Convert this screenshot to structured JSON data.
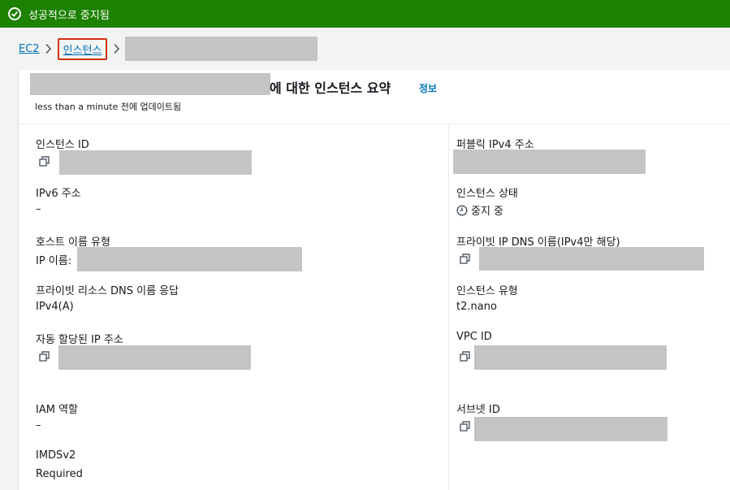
{
  "banner": {
    "message": "성공적으로 중지됨"
  },
  "breadcrumb": {
    "ec2": "EC2",
    "instances": "인스턴스"
  },
  "summary": {
    "title_suffix": "에 대한 인스턴스 요약",
    "info": "정보",
    "updated": "less than a minute 전에 업데이트됨"
  },
  "fields": {
    "instance_id": {
      "label": "인스턴스 ID"
    },
    "ipv6": {
      "label": "IPv6 주소",
      "value": "–"
    },
    "hostname_type": {
      "label": "호스트 이름 유형",
      "value_prefix": "IP 이름:"
    },
    "private_dns_answer": {
      "label": "프라이빗 리소스 DNS 이름 응답",
      "value": "IPv4(A)"
    },
    "auto_ip": {
      "label": "자동 할당된 IP 주소"
    },
    "iam_role": {
      "label": "IAM 역할",
      "value": "–"
    },
    "imdsv2": {
      "label": "IMDSv2",
      "value": "Required"
    },
    "public_ipv4": {
      "label": "퍼블릭 IPv4 주소"
    },
    "instance_state": {
      "label": "인스턴스 상태",
      "value": "중지 중"
    },
    "private_dns": {
      "label": "프라이빗 IP DNS 이름(IPv4만 해당)"
    },
    "instance_type": {
      "label": "인스턴스 유형",
      "value": "t2.nano"
    },
    "vpc_id": {
      "label": "VPC ID"
    },
    "subnet_id": {
      "label": "서브넷 ID"
    }
  },
  "colors": {
    "success": "#1d8102",
    "link": "#0073bb",
    "highlight": "#d13212",
    "redaction": "#c4c4c4"
  },
  "icons": [
    "check-circle-icon",
    "chevron-right-icon",
    "copy-icon",
    "clock-icon"
  ]
}
